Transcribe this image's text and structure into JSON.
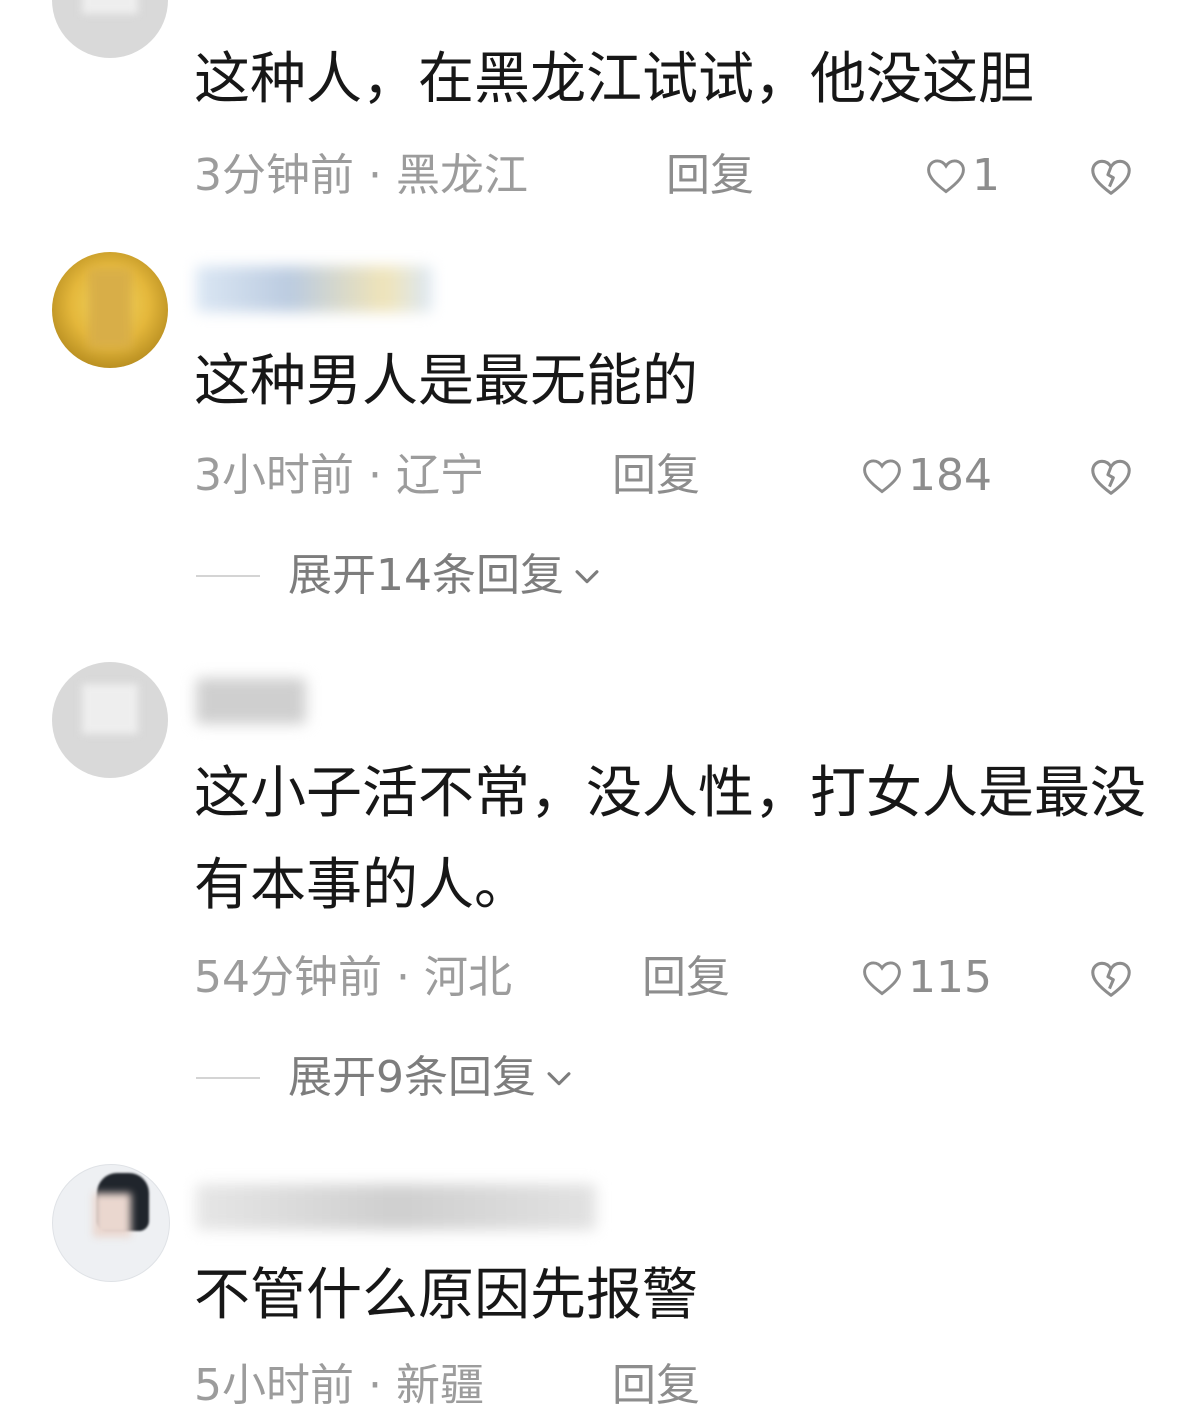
{
  "comments": [
    {
      "text": "这种人，在黑龙江试试，他没这胆",
      "time": "3分钟前",
      "separator": "·",
      "region": "黑龙江",
      "reply_label": "回复",
      "likes": "1"
    },
    {
      "text": "这种男人是最无能的",
      "time": "3小时前",
      "separator": "·",
      "region": "辽宁",
      "reply_label": "回复",
      "likes": "184",
      "expand_label": "展开14条回复"
    },
    {
      "text": "这小子活不常，没人性，打女人是最没有本事的人。",
      "time": "54分钟前",
      "separator": "·",
      "region": "河北",
      "reply_label": "回复",
      "likes": "115",
      "expand_label": "展开9条回复"
    },
    {
      "text": "不管什么原因先报警",
      "time": "5小时前",
      "separator": "·",
      "region": "新疆",
      "reply_label": "回复"
    }
  ],
  "icons": {
    "like": "heart-outline-icon",
    "dislike": "broken-heart-icon",
    "expand": "chevron-down-icon"
  },
  "colors": {
    "text": "#171717",
    "meta": "#9c9c9c",
    "muted": "#8d8d8d"
  }
}
